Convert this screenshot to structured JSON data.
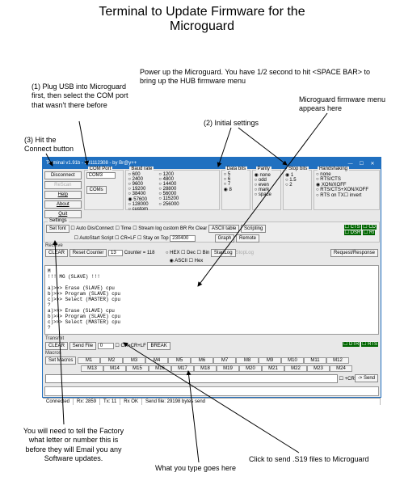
{
  "title_line1": "Terminal to Update Firmware for the",
  "title_line2": "Microguard",
  "annotations": {
    "a1": "(1) Plug USB into Microguard first, then select the COM port that wasn't there before",
    "a2": "(2) Initial settings",
    "a3": "(3) Hit the Connect button",
    "a4": "Power up the Microguard. You have 1/2 second to hit <SPACE BAR> to bring up the HUB firmware menu",
    "a5": "Microguard firmware menu appears here",
    "a6": "You will need to tell the Factory what letter or number this is before they will Email you any Software updates.",
    "a7": "What you type goes here",
    "a8": "Click to send .S19 files to Microguard"
  },
  "window": {
    "title": "Terminal v1.91b - 201112308 - by Br@y++",
    "win_min": "—",
    "win_max": "☐",
    "win_close": "✕",
    "left_buttons": {
      "disconnect": "Disconnect",
      "rescan": "ReScan",
      "help": "Help",
      "about": "About",
      "quit": "Quit"
    },
    "com": {
      "title": "COM Port",
      "value": "COM3",
      "coms": "COMs"
    },
    "baud": {
      "title": "Baud rate",
      "opts": [
        "600",
        "1200",
        "2400",
        "4800",
        "9600",
        "14400",
        "19200",
        "28800",
        "38400",
        "56000",
        "57600",
        "115200",
        "128000",
        "256000",
        "custom"
      ],
      "sel": "57600"
    },
    "databits": {
      "title": "Data bits",
      "opts": [
        "5",
        "6",
        "7",
        "8"
      ],
      "sel": "8"
    },
    "parity": {
      "title": "Parity",
      "opts": [
        "none",
        "odd",
        "even",
        "mark",
        "space"
      ],
      "sel": "none"
    },
    "stopbits": {
      "title": "Stop bits",
      "opts": [
        "1",
        "1.5",
        "2"
      ],
      "sel": "1"
    },
    "handshake": {
      "title": "Handshaking",
      "opts": [
        "none",
        "RTS/CTS",
        "XON/XOFF",
        "RTS/CTS+XON/XOFF",
        "RTS on TX",
        "invert"
      ],
      "sel": "XON/XOFF"
    },
    "settings_title": "Settings",
    "settings": {
      "setfont": "Set font",
      "autodis": "Auto Dis/Connect",
      "autoscr": "AutoStart Script",
      "time": "Time",
      "crlf": "CR=LF",
      "streamlog": "Stream log",
      "stayontop": "Stay on Top",
      "custombr": "custom BR",
      "custombr_val": "230400",
      "rxclear": "Rx Clear",
      "ascii_table": "ASCII table",
      "graph": "Graph",
      "scripting": "Scripting",
      "remote": "Remote"
    },
    "indicators": {
      "cts": "CTS",
      "dsr": "DSR",
      "cd": "CD",
      "ri": "RI"
    },
    "receive": {
      "title": "Receive",
      "clear": "CLEAR",
      "reset": "Reset Counter",
      "cntfield": "13",
      "counter_lbl": "Counter = 118",
      "hex_chk": "HEX",
      "ascii_chk": "ASCII",
      "dec": "Dec",
      "hex": "Hex",
      "bin": "Bin",
      "startlog": "StartLog",
      "stoplog": "StopLog",
      "reqresp": "Request/Response"
    },
    "terminal_text": "M\n!!! MG (SLAVE) !!!\n\na)>>> Erase (SLAVE) cpu\nb)>>> Program (SLAVE) cpu\nc)>>> Select (MASTER) cpu\n?\na)>>> Erase (SLAVE) cpu\nb)>>> Program (SLAVE) cpu\nc)>>> Select (MASTER) cpu\n?",
    "transmit": {
      "title": "Transmit",
      "clear": "CLEAR",
      "sendfile": "Send File",
      "num": "0",
      "crcrlf": "CR=CR+LF",
      "break": "BREAK",
      "dtr": "DTR",
      "rts": "RTS"
    },
    "macros": {
      "title": "Macros",
      "set": "Set Macros",
      "row1": [
        "M1",
        "M2",
        "M3",
        "M4",
        "M5",
        "M6",
        "M7",
        "M8",
        "M9",
        "M10",
        "M11",
        "M12"
      ],
      "row2": [
        "M13",
        "M14",
        "M15",
        "M16",
        "M17",
        "M18",
        "M19",
        "M20",
        "M21",
        "M22",
        "M23",
        "M24"
      ]
    },
    "sendline": {
      "cr": "+CR",
      "send": "-> Send"
    },
    "status": {
      "conn": "Connected",
      "rx": "Rx: 2859",
      "tx": "Tx: 11",
      "rxok": "Rx OK",
      "sendfile": "Send file: 29198 bytes send"
    }
  }
}
